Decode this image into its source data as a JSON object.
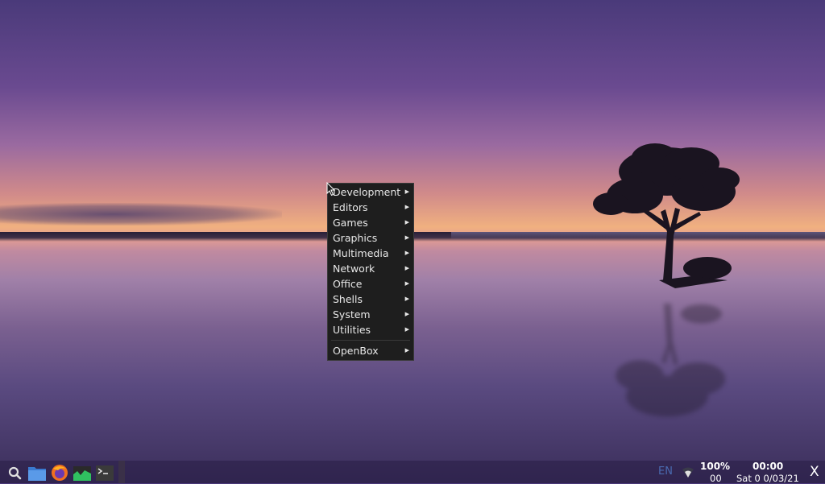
{
  "desktop": {
    "wallpaper": "lake-sunset-with-tree"
  },
  "menu": {
    "items": [
      {
        "label": "Development",
        "submenu": true
      },
      {
        "label": "Editors",
        "submenu": true
      },
      {
        "label": "Games",
        "submenu": true
      },
      {
        "label": "Graphics",
        "submenu": true
      },
      {
        "label": "Multimedia",
        "submenu": true
      },
      {
        "label": "Network",
        "submenu": true
      },
      {
        "label": "Office",
        "submenu": true
      },
      {
        "label": "Shells",
        "submenu": true
      },
      {
        "label": "System",
        "submenu": true
      },
      {
        "label": "Utilities",
        "submenu": true
      }
    ],
    "footer_item": {
      "label": "OpenBox",
      "submenu": true
    },
    "arrow_glyph": "▶"
  },
  "taskbar": {
    "launchers": [
      "search-icon",
      "file-manager-icon",
      "firefox-icon",
      "system-monitor-icon",
      "terminal-icon"
    ],
    "keyboard_layout": "EN",
    "battery_percent": "100%",
    "battery_sub": "00",
    "clock_time": "00:00",
    "clock_date": "Sat 0 0/03/21",
    "close_label": "X",
    "colors": {
      "lang": "#4a6ab0",
      "menu_bg": "#1e1e1e"
    }
  }
}
